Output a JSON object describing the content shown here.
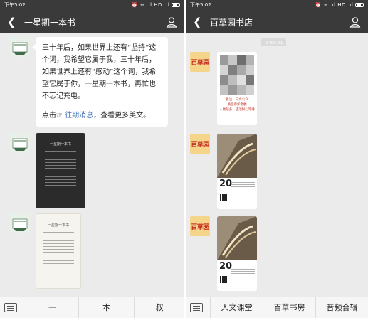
{
  "left": {
    "status": {
      "time": "下午5:02",
      "icons": "... ⏰ ≋ .ıl HD .ıl"
    },
    "title": "一星期一本书",
    "message": {
      "para1": "三十年后，如果世界上还有“坚持”这个词，我希望它属于我，三十年后，如果世界上还有“感动”这个词，我希望它属于你，一星期一本书，再忙也不忘记充电。",
      "prefix": "点击☞ ",
      "link": "往期消息",
      "suffix": "，查看更多美文。"
    },
    "cards": [
      {
        "title": "一星期一本书"
      },
      {
        "title": "一星期一本书"
      }
    ],
    "menu": [
      "一",
      "本",
      "叔"
    ]
  },
  "right": {
    "status": {
      "time": "下午5:02",
      "icons": "... ⏰ ≋ .ıl HD .ıl"
    },
    "title": "百草园书店",
    "timestamp": "下午5:01",
    "avatar_text": "百草园",
    "poster1_caption": "备注：日文公众\n换后参加老梗\n人数较多，还须耐心等待",
    "poster_number": "20",
    "menu": [
      "人文课堂",
      "百草书房",
      "音频合辑"
    ]
  },
  "colors": {
    "titlebar": "#3a3a3a",
    "background": "#ebebeb",
    "link": "#3b6fb6",
    "brand_red": "#c4271f"
  }
}
